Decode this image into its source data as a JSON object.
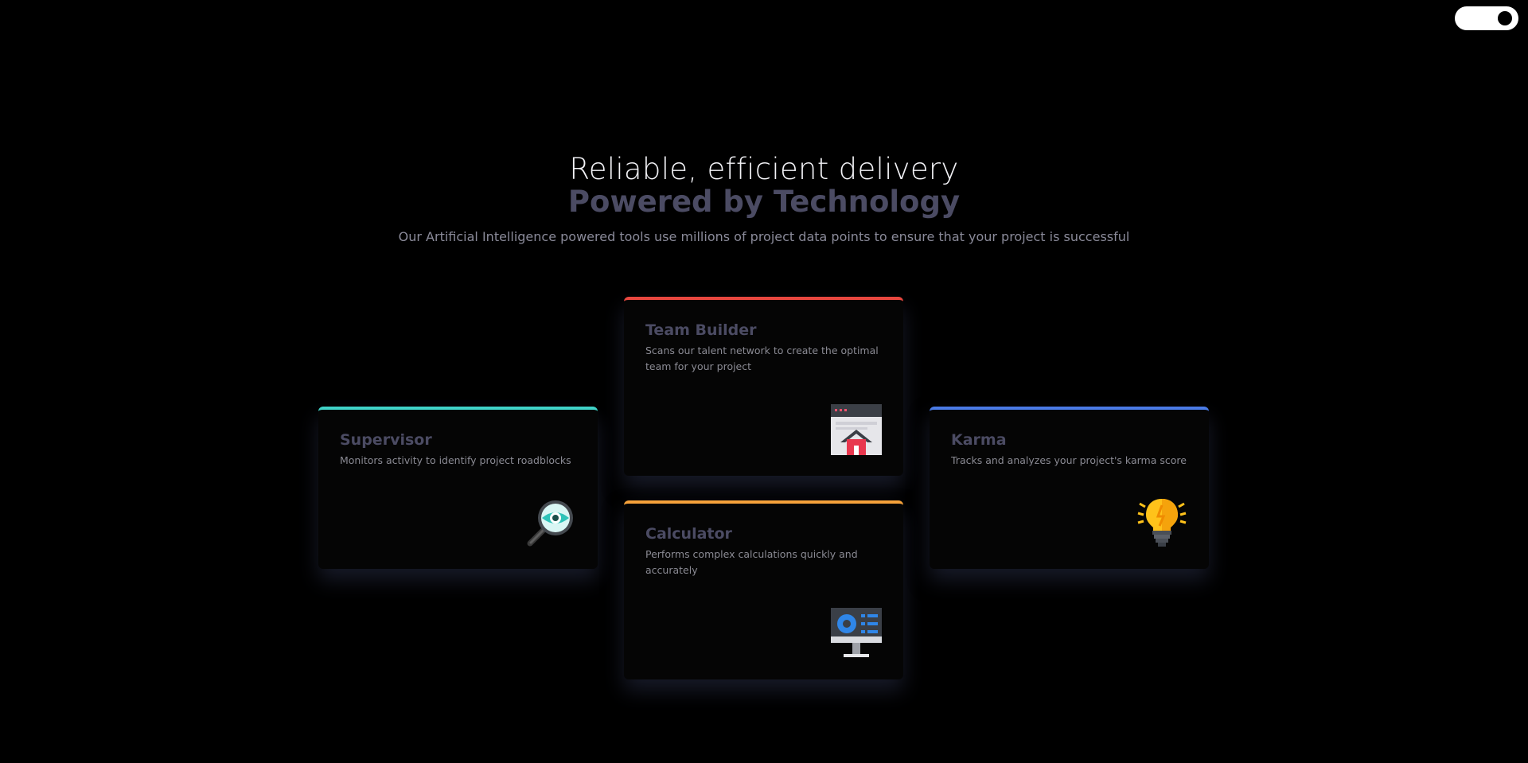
{
  "hero": {
    "line1": "Reliable, efficient delivery",
    "line2": "Powered by Technology",
    "subtitle": "Our Artificial Intelligence powered tools use millions of project data points to ensure that your project is successful"
  },
  "cards": [
    {
      "title": "Supervisor",
      "description": "Monitors activity to identify project roadblocks",
      "accent": "#40d3c8",
      "icon": "magnifier-eye-icon"
    },
    {
      "title": "Team Builder",
      "description": "Scans our talent network to create the optimal team for your project",
      "accent": "#e8473f",
      "icon": "browser-house-icon"
    },
    {
      "title": "Calculator",
      "description": "Performs complex calculations quickly and accurately",
      "accent": "#f6a23a",
      "icon": "monitor-dashboard-icon"
    },
    {
      "title": "Karma",
      "description": "Tracks and analyzes your project's karma score",
      "accent": "#4a7be6",
      "icon": "lightbulb-icon"
    }
  ],
  "theme_toggle": {
    "state": "on",
    "color": "#ffffff"
  }
}
